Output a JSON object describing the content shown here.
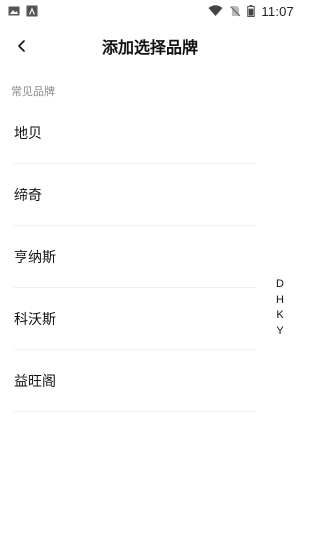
{
  "status_bar": {
    "time": "11:07",
    "left_icons": [
      "image-icon",
      "app-icon"
    ],
    "right_icons": [
      "wifi-icon",
      "no-sim-icon",
      "battery-icon"
    ]
  },
  "header": {
    "back_icon": "chevron-left-icon",
    "title": "添加选择品牌"
  },
  "section": {
    "label": "常见品牌"
  },
  "brands": [
    {
      "label": "地贝"
    },
    {
      "label": "缔奇"
    },
    {
      "label": "亨纳斯"
    },
    {
      "label": "科沃斯"
    },
    {
      "label": "益旺阁"
    }
  ],
  "index_letters": [
    "D",
    "H",
    "K",
    "Y"
  ],
  "colors": {
    "background": "#ffffff",
    "text": "#111111",
    "muted": "#8a8a8a",
    "divider": "#efefef"
  }
}
